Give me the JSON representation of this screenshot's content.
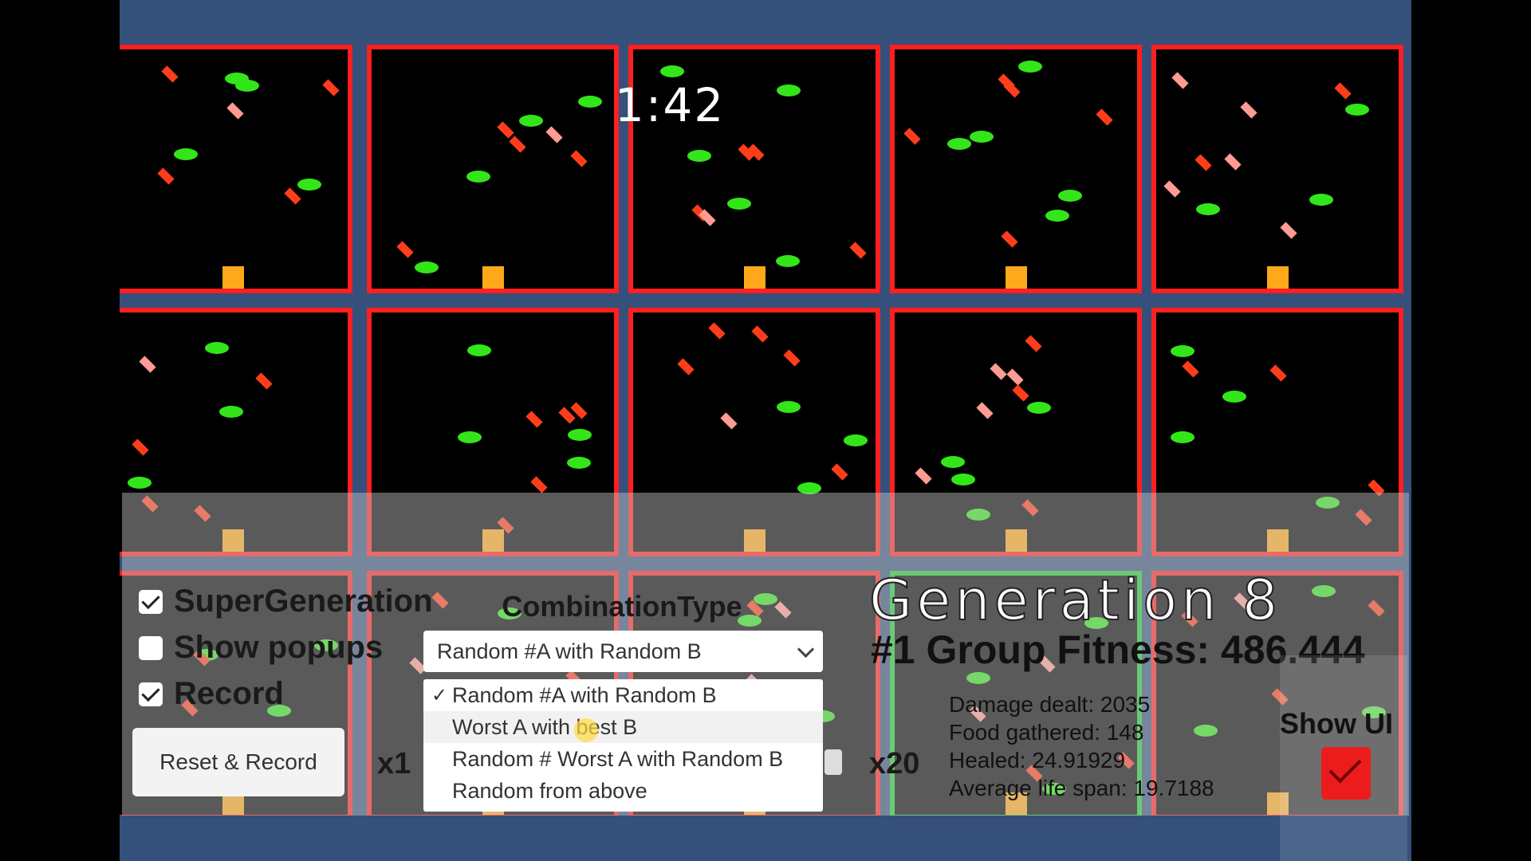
{
  "timer": "1:42",
  "controls": {
    "supergeneration": {
      "label": "SuperGeneration",
      "checked": true
    },
    "show_popups": {
      "label": "Show popups",
      "checked": false
    },
    "record": {
      "label": "Record",
      "checked": true
    },
    "reset_button": "Reset & Record"
  },
  "combination": {
    "title": "CombinationType",
    "selected": "Random #A with Random B",
    "options": [
      "Random #A with Random B",
      "Worst A with best B",
      "Random # Worst A with Random B",
      "Random from above"
    ],
    "selected_index": 0,
    "highlighted_index": 1
  },
  "speed": {
    "min_label": "x1",
    "max_label": "x20"
  },
  "generation": {
    "title": "Generation 8",
    "fitness": "#1 Group Fitness: 486.444",
    "stats": [
      "Damage dealt: 2035",
      "Food gathered: 148",
      "Healed: 24.91929",
      "Average life span: 19.7188"
    ]
  },
  "show_ui": {
    "label": "Show UI",
    "checked": true
  },
  "colors": {
    "background": "#34507b",
    "cell_border": "#ff1f1f",
    "best_border": "#22cc33",
    "food": "#33e61a",
    "enemy": "#ff3d1a",
    "base": "#ffa81a"
  }
}
